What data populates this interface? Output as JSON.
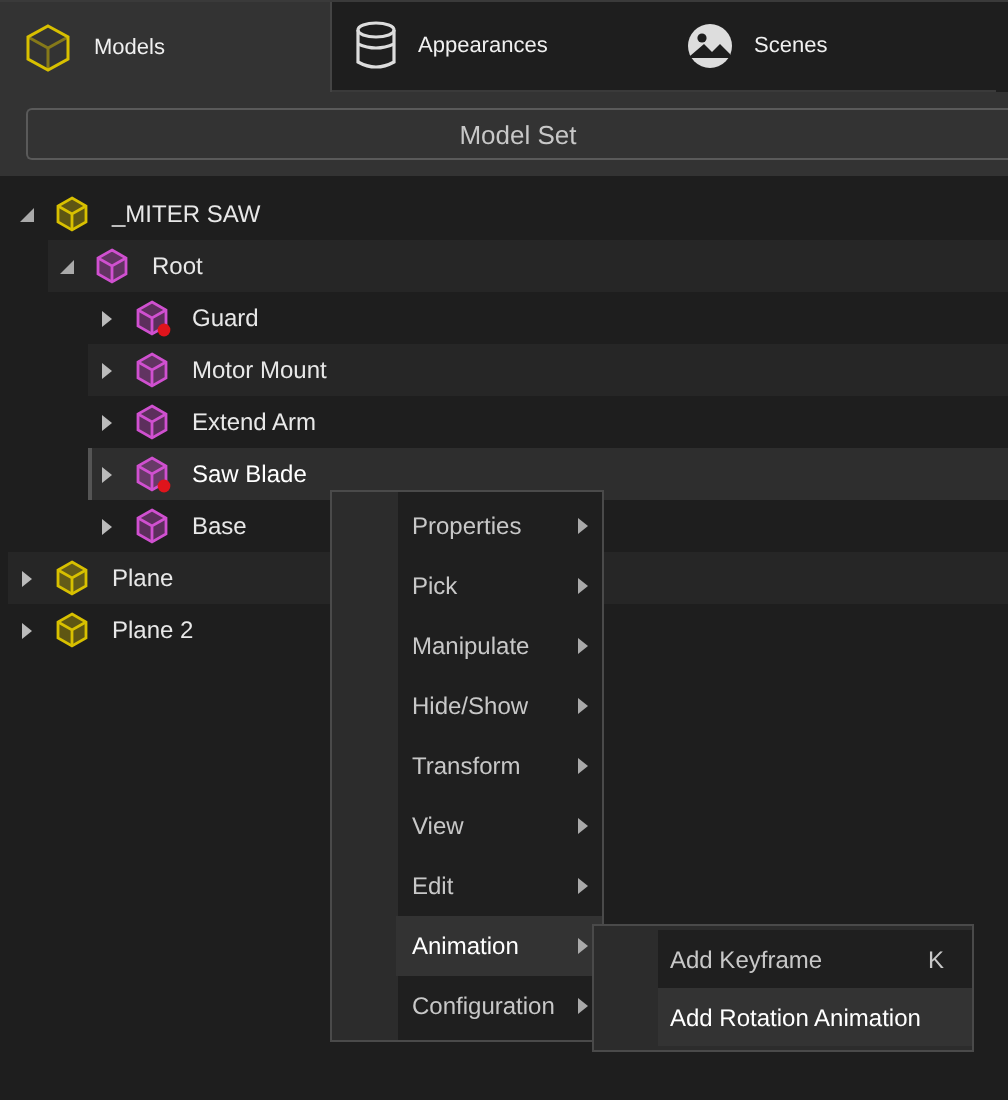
{
  "tabs": [
    {
      "label": "Models",
      "selected": true
    },
    {
      "label": "Appearances",
      "selected": false
    },
    {
      "label": "Scenes",
      "selected": false
    }
  ],
  "model_set_button": "Model Set",
  "tree": [
    {
      "label": "_MITER SAW",
      "kind": "assembly",
      "expanded": true,
      "selected": false,
      "flagged": false,
      "children": [
        {
          "label": "Root",
          "kind": "part",
          "expanded": true,
          "selected": false,
          "flagged": false,
          "children": [
            {
              "label": "Guard",
              "kind": "part",
              "expanded": false,
              "selected": false,
              "flagged": true
            },
            {
              "label": "Motor Mount",
              "kind": "part",
              "expanded": false,
              "selected": false,
              "flagged": false
            },
            {
              "label": "Extend Arm",
              "kind": "part",
              "expanded": false,
              "selected": false,
              "flagged": false
            },
            {
              "label": "Saw Blade",
              "kind": "part",
              "expanded": false,
              "selected": true,
              "flagged": true
            },
            {
              "label": "Base",
              "kind": "part",
              "expanded": false,
              "selected": false,
              "flagged": false
            }
          ]
        }
      ]
    },
    {
      "label": "Plane",
      "kind": "assembly",
      "expanded": false,
      "selected": false,
      "flagged": false
    },
    {
      "label": "Plane 2",
      "kind": "assembly",
      "expanded": false,
      "selected": false,
      "flagged": false
    }
  ],
  "context_menu": [
    {
      "label": "Properties",
      "selected": false
    },
    {
      "label": "Pick",
      "selected": false
    },
    {
      "label": "Manipulate",
      "selected": false
    },
    {
      "label": "Hide/Show",
      "selected": false
    },
    {
      "label": "Transform",
      "selected": false
    },
    {
      "label": "View",
      "selected": false
    },
    {
      "label": "Edit",
      "selected": false
    },
    {
      "label": "Animation",
      "selected": true
    },
    {
      "label": "Configuration",
      "selected": false
    }
  ],
  "submenu": [
    {
      "label": "Add Keyframe",
      "shortcut": "K",
      "selected": false
    },
    {
      "label": "Add Rotation Animation",
      "selected": true
    }
  ]
}
